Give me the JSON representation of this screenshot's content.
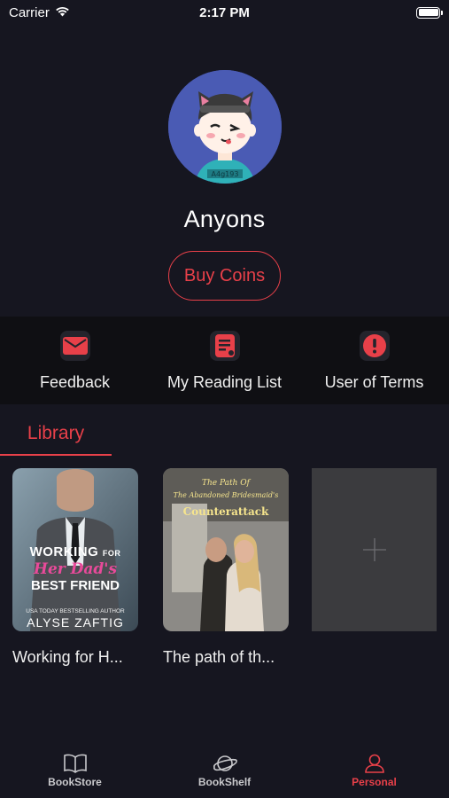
{
  "status_bar": {
    "carrier": "Carrier",
    "time": "2:17 PM"
  },
  "profile": {
    "username": "Anyons",
    "buy_coins_label": "Buy Coins"
  },
  "actions": [
    {
      "label": "Feedback",
      "icon": "mail-icon"
    },
    {
      "label": "My Reading List",
      "icon": "document-icon"
    },
    {
      "label": "User of Terms",
      "icon": "alert-icon"
    }
  ],
  "library": {
    "tab_label": "Library",
    "books": [
      {
        "title": "Working for H...",
        "cover_line1": "WORKING",
        "cover_line1b": "FOR",
        "cover_line2": "Her Dad's",
        "cover_line3": "BEST FRIEND",
        "cover_tagline": "USA TODAY BESTSELLING AUTHOR",
        "cover_author": "ALYSE ZAFTIG"
      },
      {
        "title": "The path of th...",
        "cover_line1": "The Path Of",
        "cover_line2": "The Abandoned Bridesmaid's",
        "cover_line3": "Counterattack"
      }
    ],
    "add_icon": "plus-icon"
  },
  "tabbar": {
    "tabs": [
      {
        "label": "BookStore",
        "icon": "book-open-icon"
      },
      {
        "label": "BookShelf",
        "icon": "planet-icon"
      },
      {
        "label": "Personal",
        "icon": "user-icon"
      }
    ],
    "active": "Personal"
  },
  "colors": {
    "accent": "#e84049",
    "background": "#161620",
    "action_bar": "#0f0f13",
    "add_tile": "#3b3b3e"
  }
}
